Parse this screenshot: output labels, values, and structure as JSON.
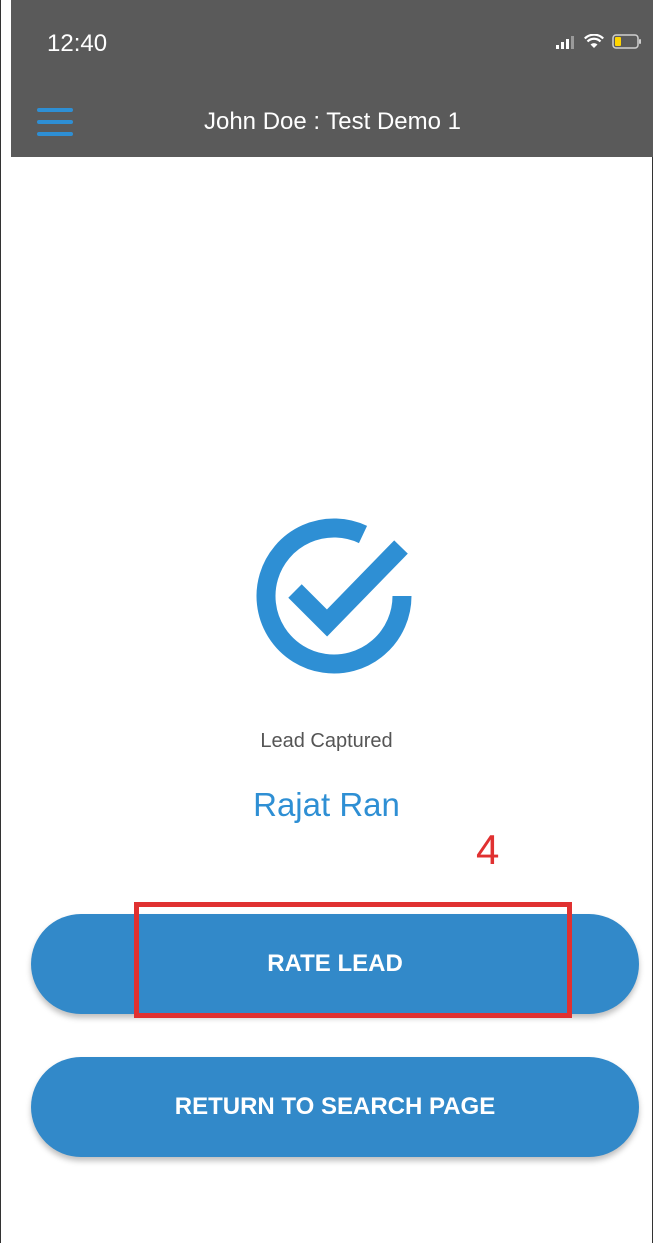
{
  "status_bar": {
    "time": "12:40",
    "icons": [
      "signal-icon",
      "wifi-icon",
      "battery-icon"
    ]
  },
  "nav": {
    "title": "John Doe : Test Demo 1",
    "menu_icon": "hamburger-menu-icon"
  },
  "result": {
    "icon": "check-circle-icon",
    "status_label": "Lead Captured",
    "lead_name": "Rajat Ran"
  },
  "annotation": {
    "step_number": "4",
    "color": "#e03131"
  },
  "buttons": {
    "rate_lead": "RATE LEAD",
    "return_to_search": "RETURN TO SEARCH PAGE"
  },
  "colors": {
    "accent": "#2e8fd4",
    "button": "#3289c9",
    "header": "#5a5a5a"
  }
}
